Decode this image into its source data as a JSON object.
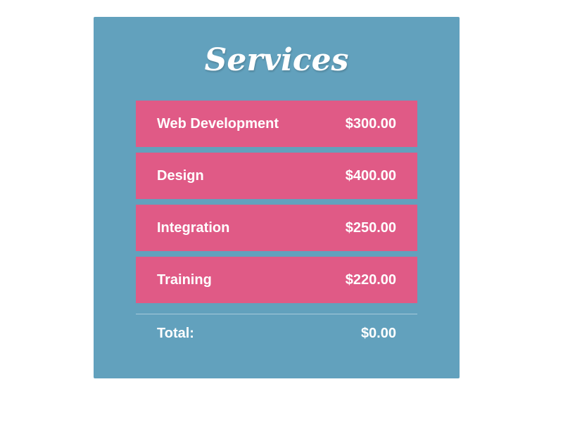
{
  "title": "Services",
  "services": [
    {
      "name": "Web Development",
      "price": "$300.00"
    },
    {
      "name": "Design",
      "price": "$400.00"
    },
    {
      "name": "Integration",
      "price": "$250.00"
    },
    {
      "name": "Training",
      "price": "$220.00"
    }
  ],
  "total": {
    "label": "Total:",
    "value": "$0.00"
  },
  "colors": {
    "panel_background": "#62a1bd",
    "item_background": "#e05a86",
    "text": "#ffffff"
  }
}
